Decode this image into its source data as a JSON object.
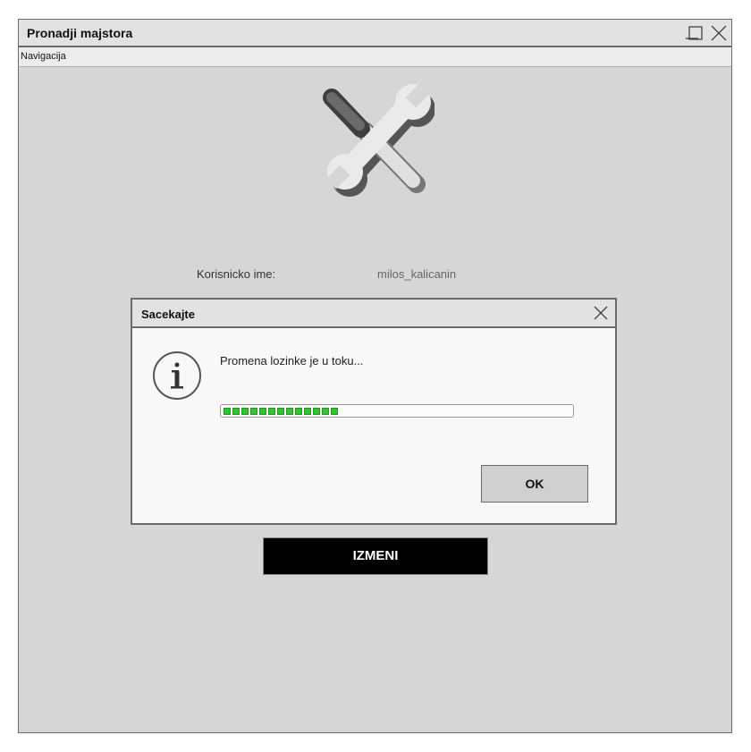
{
  "window": {
    "title": "Pronadji majstora",
    "controls": [
      "minimize-icon",
      "maximize-icon",
      "close-icon"
    ]
  },
  "menu": {
    "items": [
      {
        "label": "Navigacija"
      }
    ]
  },
  "logo": {
    "icon": "tools-icon"
  },
  "form": {
    "username_label": "Korisnicko ime:",
    "username_value": "milos_kalicanin",
    "submit_label": "IZMENI"
  },
  "dialog": {
    "title": "Sacekajte",
    "icon": "info-icon",
    "message": "Promena lozinke je u toku...",
    "progress_segments": 13,
    "progress_fraction": 0.33,
    "ok_label": "OK"
  },
  "colors": {
    "window_bg": "#d6d6d6",
    "progress_green": "#35c235",
    "primary_button": "#000000"
  }
}
